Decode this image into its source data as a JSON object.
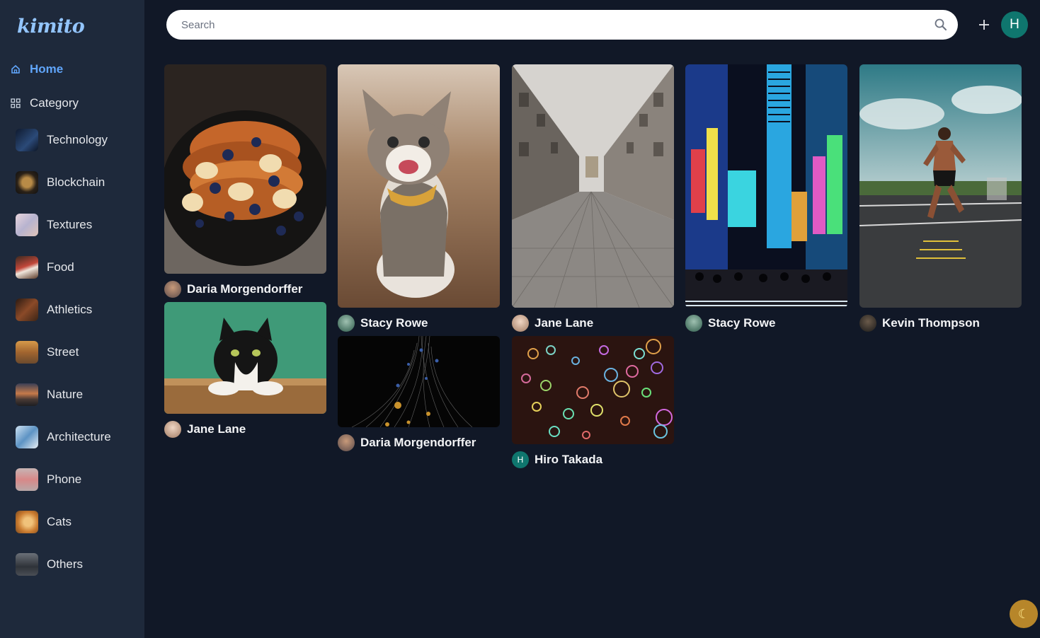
{
  "app": {
    "logo": "kimito"
  },
  "nav": {
    "home_label": "Home",
    "category_label": "Category"
  },
  "categories": [
    {
      "label": "Technology",
      "icon": "technology-thumb",
      "color": "#1f3a5f"
    },
    {
      "label": "Blockchain",
      "icon": "blockchain-thumb",
      "color": "#3b2f1f"
    },
    {
      "label": "Textures",
      "icon": "textures-thumb",
      "color": "#c7b7c9"
    },
    {
      "label": "Food",
      "icon": "food-thumb",
      "color": "#8b3a2a"
    },
    {
      "label": "Athletics",
      "icon": "athletics-thumb",
      "color": "#5a3620"
    },
    {
      "label": "Street",
      "icon": "street-thumb",
      "color": "#b0722f"
    },
    {
      "label": "Nature",
      "icon": "nature-thumb",
      "color": "#9a5c3a"
    },
    {
      "label": "Architecture",
      "icon": "architecture-thumb",
      "color": "#6fa2c7"
    },
    {
      "label": "Phone",
      "icon": "phone-thumb",
      "color": "#c9a7a7"
    },
    {
      "label": "Cats",
      "icon": "cats-thumb",
      "color": "#d18a3b"
    },
    {
      "label": "Others",
      "icon": "others-thumb",
      "color": "#4a4f55"
    }
  ],
  "search": {
    "placeholder": "Search",
    "icon": "search-icon"
  },
  "header": {
    "add_icon": "plus-icon",
    "avatar_initial": "H",
    "avatar_color": "#0f766e"
  },
  "pins": [
    {
      "author": "Daria Morgendorffer",
      "subject": "french-toast",
      "avatar_initial": ""
    },
    {
      "author": "Jane Lane",
      "subject": "cat-green-wall",
      "avatar_initial": ""
    },
    {
      "author": "Stacy Rowe",
      "subject": "meowing-cat",
      "avatar_initial": ""
    },
    {
      "author": "Daria Morgendorffer",
      "subject": "abstract-particles",
      "avatar_initial": ""
    },
    {
      "author": "Jane Lane",
      "subject": "empty-street",
      "avatar_initial": ""
    },
    {
      "author": "Hiro Takada",
      "subject": "soap-bubbles",
      "avatar_initial": "H"
    },
    {
      "author": "Stacy Rowe",
      "subject": "neon-city",
      "avatar_initial": ""
    },
    {
      "author": "Kevin Thompson",
      "subject": "athlete-training",
      "avatar_initial": ""
    }
  ],
  "theme_toggle": {
    "icon": "moon-icon",
    "glyph": "☾"
  },
  "colors": {
    "background": "#111827",
    "sidebar": "#1e293b",
    "accent": "#60a5fa"
  }
}
